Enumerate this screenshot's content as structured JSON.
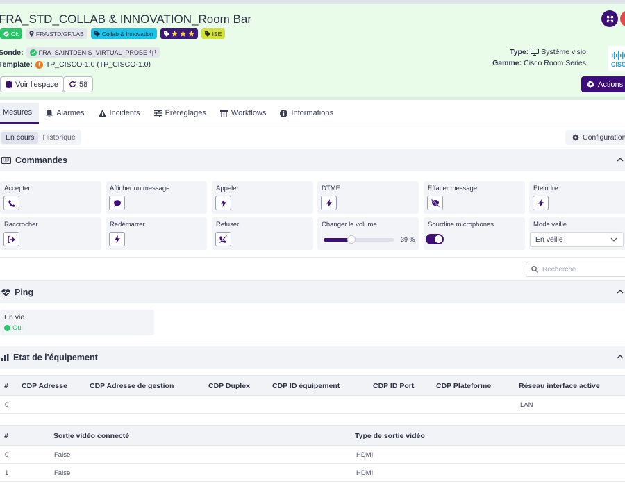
{
  "header": {
    "title": "FRA_STD_COLLAB & INNOVATION_Room Bar",
    "tags": {
      "ok": "Ok",
      "location": "FRA/STD/GF/LAB",
      "collab": "Collab & Innovation",
      "ise": "ISE"
    },
    "sonde_label": "Sonde:",
    "sonde_value": "FRA_SAINTDENIS_VIRTUAL_PROBE",
    "template_label": "Template:",
    "template_value": "TP_CISCO-1.0 (TP_CISCO-1.0)",
    "type_label": "Type:",
    "type_value": "Système visio",
    "gamme_label": "Gamme:",
    "gamme_value": "Cisco Room Series",
    "voir_espace": "Voir l'espace",
    "refresh_count": "58",
    "actions": "Actions"
  },
  "tabs": [
    {
      "label": "Mesures"
    },
    {
      "label": "Alarmes"
    },
    {
      "label": "Incidents"
    },
    {
      "label": "Préréglages"
    },
    {
      "label": "Workflows"
    },
    {
      "label": "Informations"
    }
  ],
  "subtabs": {
    "current": "En cours",
    "history": "Historique"
  },
  "configuration": "Configuration",
  "commands": {
    "title": "Commandes",
    "items": [
      {
        "label": "Accepter"
      },
      {
        "label": "Afficher un message"
      },
      {
        "label": "Appeler"
      },
      {
        "label": "DTMF"
      },
      {
        "label": "Effacer message"
      },
      {
        "label": "Eteindre"
      },
      {
        "label": "Raccrocher"
      },
      {
        "label": "Redémarrer"
      },
      {
        "label": "Refuser"
      },
      {
        "label": "Changer le volume"
      },
      {
        "label": "Sourdine microphones"
      },
      {
        "label": "Mode veille"
      }
    ],
    "volume": {
      "value": 39,
      "display": "39 %"
    },
    "mute_on": true,
    "standby_value": "En veille"
  },
  "search": {
    "placeholder": "Recherche"
  },
  "ping": {
    "title": "Ping",
    "label": "En vie",
    "value": "Oui"
  },
  "equipment": {
    "title": "Etat de l'équipement",
    "table1": {
      "headers": [
        "#",
        "CDP Adresse",
        "CDP Adresse de gestion",
        "CDP Duplex",
        "CDP ID équipement",
        "CDP ID Port",
        "CDP Plateforme",
        "Réseau interface active"
      ],
      "rows": [
        [
          "0",
          "",
          "",
          "",
          "",
          "",
          "",
          "LAN"
        ]
      ]
    },
    "table2": {
      "headers": [
        "#",
        "Sortie vidéo connecté",
        "Type de sortie vidéo"
      ],
      "rows": [
        [
          "0",
          "False",
          "HDMI"
        ],
        [
          "1",
          "False",
          "HDMI"
        ]
      ]
    }
  },
  "colors": {
    "accent": "#3d0e7a",
    "header_bg": "#e9fbe9",
    "ok_green": "#2bc66a",
    "warning_orange": "#f07a1a",
    "alert_red": "#e5484d"
  }
}
